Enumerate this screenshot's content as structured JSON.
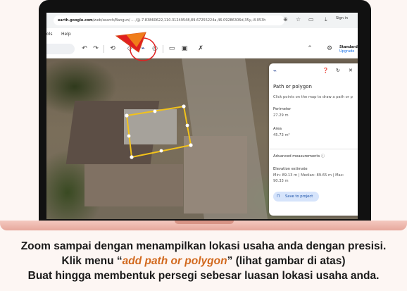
{
  "browser": {
    "url_domain": "earth.google.com",
    "url_rest": "/web/search/Bangun/ ... /@-7.83860622,110.31249548,89.67255224a,46.09286306d,35y,-8.053h",
    "sign_in": "Sign in"
  },
  "menu": {
    "file_partial": "ols",
    "help": "Help"
  },
  "toolbar": {
    "icons": [
      "undo-icon",
      "redo-icon",
      "history-icon",
      "add-placemark-icon",
      "add-path-polygon-icon",
      "layers-icon",
      "ruler-icon",
      "screenshot-icon",
      "tools-icon",
      "chevron-up-icon",
      "gear-icon"
    ],
    "standard_label": "Standard",
    "upgrade_label": "Upgrade"
  },
  "panel": {
    "heading": "Path or polygon",
    "instruction": "Click points on the map to draw a path or p",
    "perimeter_label": "Perimeter",
    "perimeter_value": "27.29 m",
    "area_label": "Area",
    "area_value": "45.73 m²",
    "advanced_label": "Advanced measurements",
    "elevation_label": "Elevation estimate",
    "elevation_line1": "Min: 89.13 m | Median: 89.65 m | Max:",
    "elevation_line2": "90.33 m",
    "save_label": "Save to project"
  },
  "caption": {
    "line1": "Zoom sampai dengan menampilkan lokasi usaha anda dengan presisi.",
    "line2_prefix": "Klik menu “",
    "line2_highlight": "add path or polygon",
    "line2_suffix": "”  (lihat gambar di atas)",
    "line3": "Buat hingga membentuk persegi sebesar luasan lokasi usaha anda."
  },
  "colors": {
    "polygon": "#f2c21b",
    "annotation": "#e02020",
    "accent": "#d2691e",
    "laptop_base": "#efb7ab"
  }
}
